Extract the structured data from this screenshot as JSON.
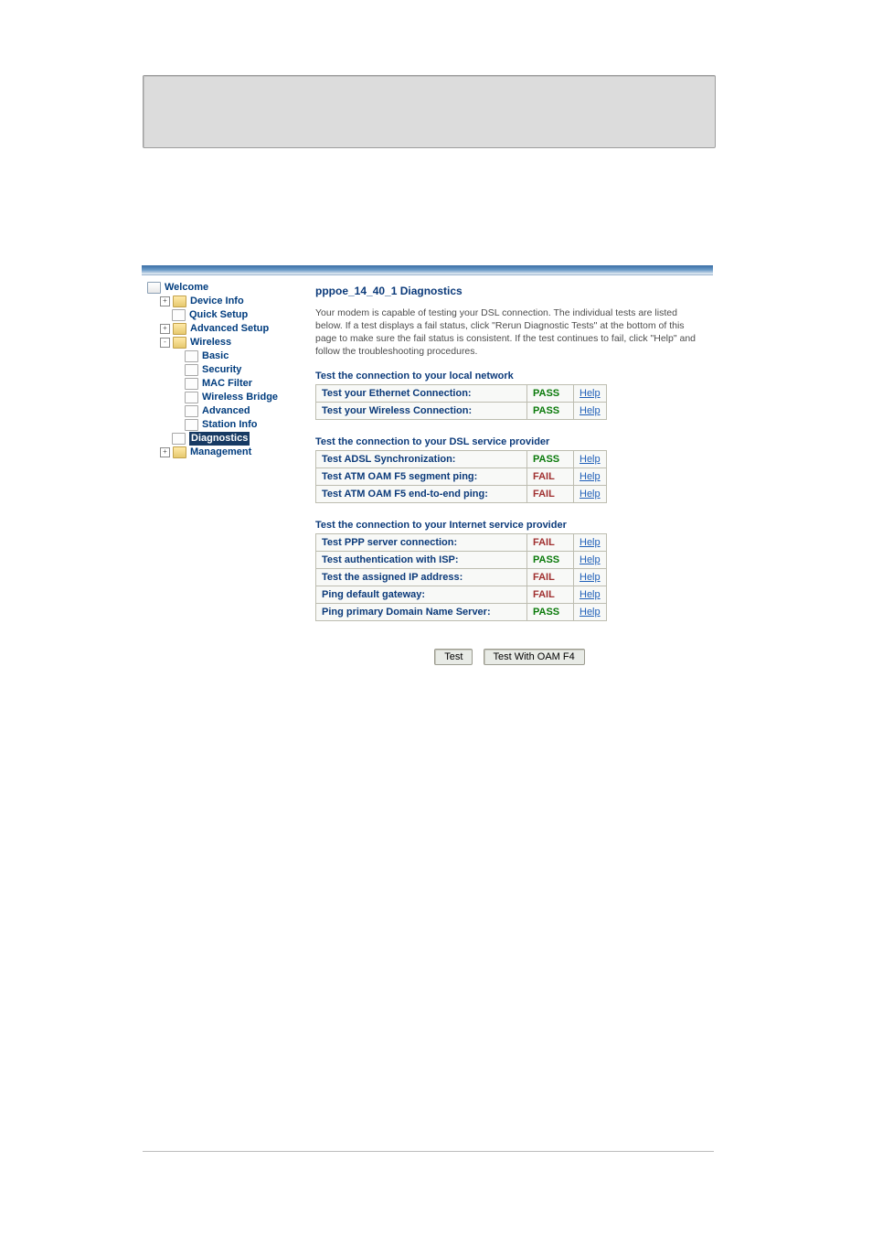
{
  "sidebar": {
    "root": "Welcome",
    "items": [
      {
        "label": "Device Info",
        "icon": "folder",
        "indent": 1,
        "exp": "+"
      },
      {
        "label": "Quick Setup",
        "icon": "page",
        "indent": 1,
        "exp": ""
      },
      {
        "label": "Advanced Setup",
        "icon": "folder",
        "indent": 1,
        "exp": "+"
      },
      {
        "label": "Wireless",
        "icon": "folder",
        "indent": 1,
        "exp": "-"
      },
      {
        "label": "Basic",
        "icon": "page",
        "indent": 2,
        "exp": ""
      },
      {
        "label": "Security",
        "icon": "page",
        "indent": 2,
        "exp": ""
      },
      {
        "label": "MAC Filter",
        "icon": "page",
        "indent": 2,
        "exp": ""
      },
      {
        "label": "Wireless Bridge",
        "icon": "page",
        "indent": 2,
        "exp": ""
      },
      {
        "label": "Advanced",
        "icon": "page",
        "indent": 2,
        "exp": ""
      },
      {
        "label": "Station Info",
        "icon": "page",
        "indent": 2,
        "exp": ""
      },
      {
        "label": "Diagnostics",
        "icon": "page",
        "indent": 1,
        "exp": "",
        "selected": true
      },
      {
        "label": "Management",
        "icon": "folder",
        "indent": 1,
        "exp": "+"
      }
    ]
  },
  "content": {
    "title": "pppoe_14_40_1 Diagnostics",
    "intro": "Your modem is capable of testing your DSL connection. The individual tests are listed below. If a test displays a fail status, click \"Rerun Diagnostic Tests\" at the bottom of this page to make sure the fail status is consistent. If the test continues to fail, click \"Help\" and follow the troubleshooting procedures.",
    "help_label": "Help",
    "sections": [
      {
        "heading": "Test the connection to your local network",
        "rows": [
          {
            "name": "Test your Ethernet Connection:",
            "status": "PASS"
          },
          {
            "name": "Test your Wireless Connection:",
            "status": "PASS"
          }
        ]
      },
      {
        "heading": "Test the connection to your DSL service provider",
        "rows": [
          {
            "name": "Test ADSL Synchronization:",
            "status": "PASS"
          },
          {
            "name": "Test ATM OAM F5 segment ping:",
            "status": "FAIL"
          },
          {
            "name": "Test ATM OAM F5 end-to-end ping:",
            "status": "FAIL"
          }
        ]
      },
      {
        "heading": "Test the connection to your Internet service provider",
        "rows": [
          {
            "name": "Test PPP server connection:",
            "status": "FAIL"
          },
          {
            "name": "Test authentication with ISP:",
            "status": "PASS"
          },
          {
            "name": "Test the assigned IP address:",
            "status": "FAIL"
          },
          {
            "name": "Ping default gateway:",
            "status": "FAIL"
          },
          {
            "name": "Ping primary Domain Name Server:",
            "status": "PASS"
          }
        ]
      }
    ],
    "buttons": {
      "test": "Test",
      "test_f4": "Test With OAM F4"
    }
  }
}
